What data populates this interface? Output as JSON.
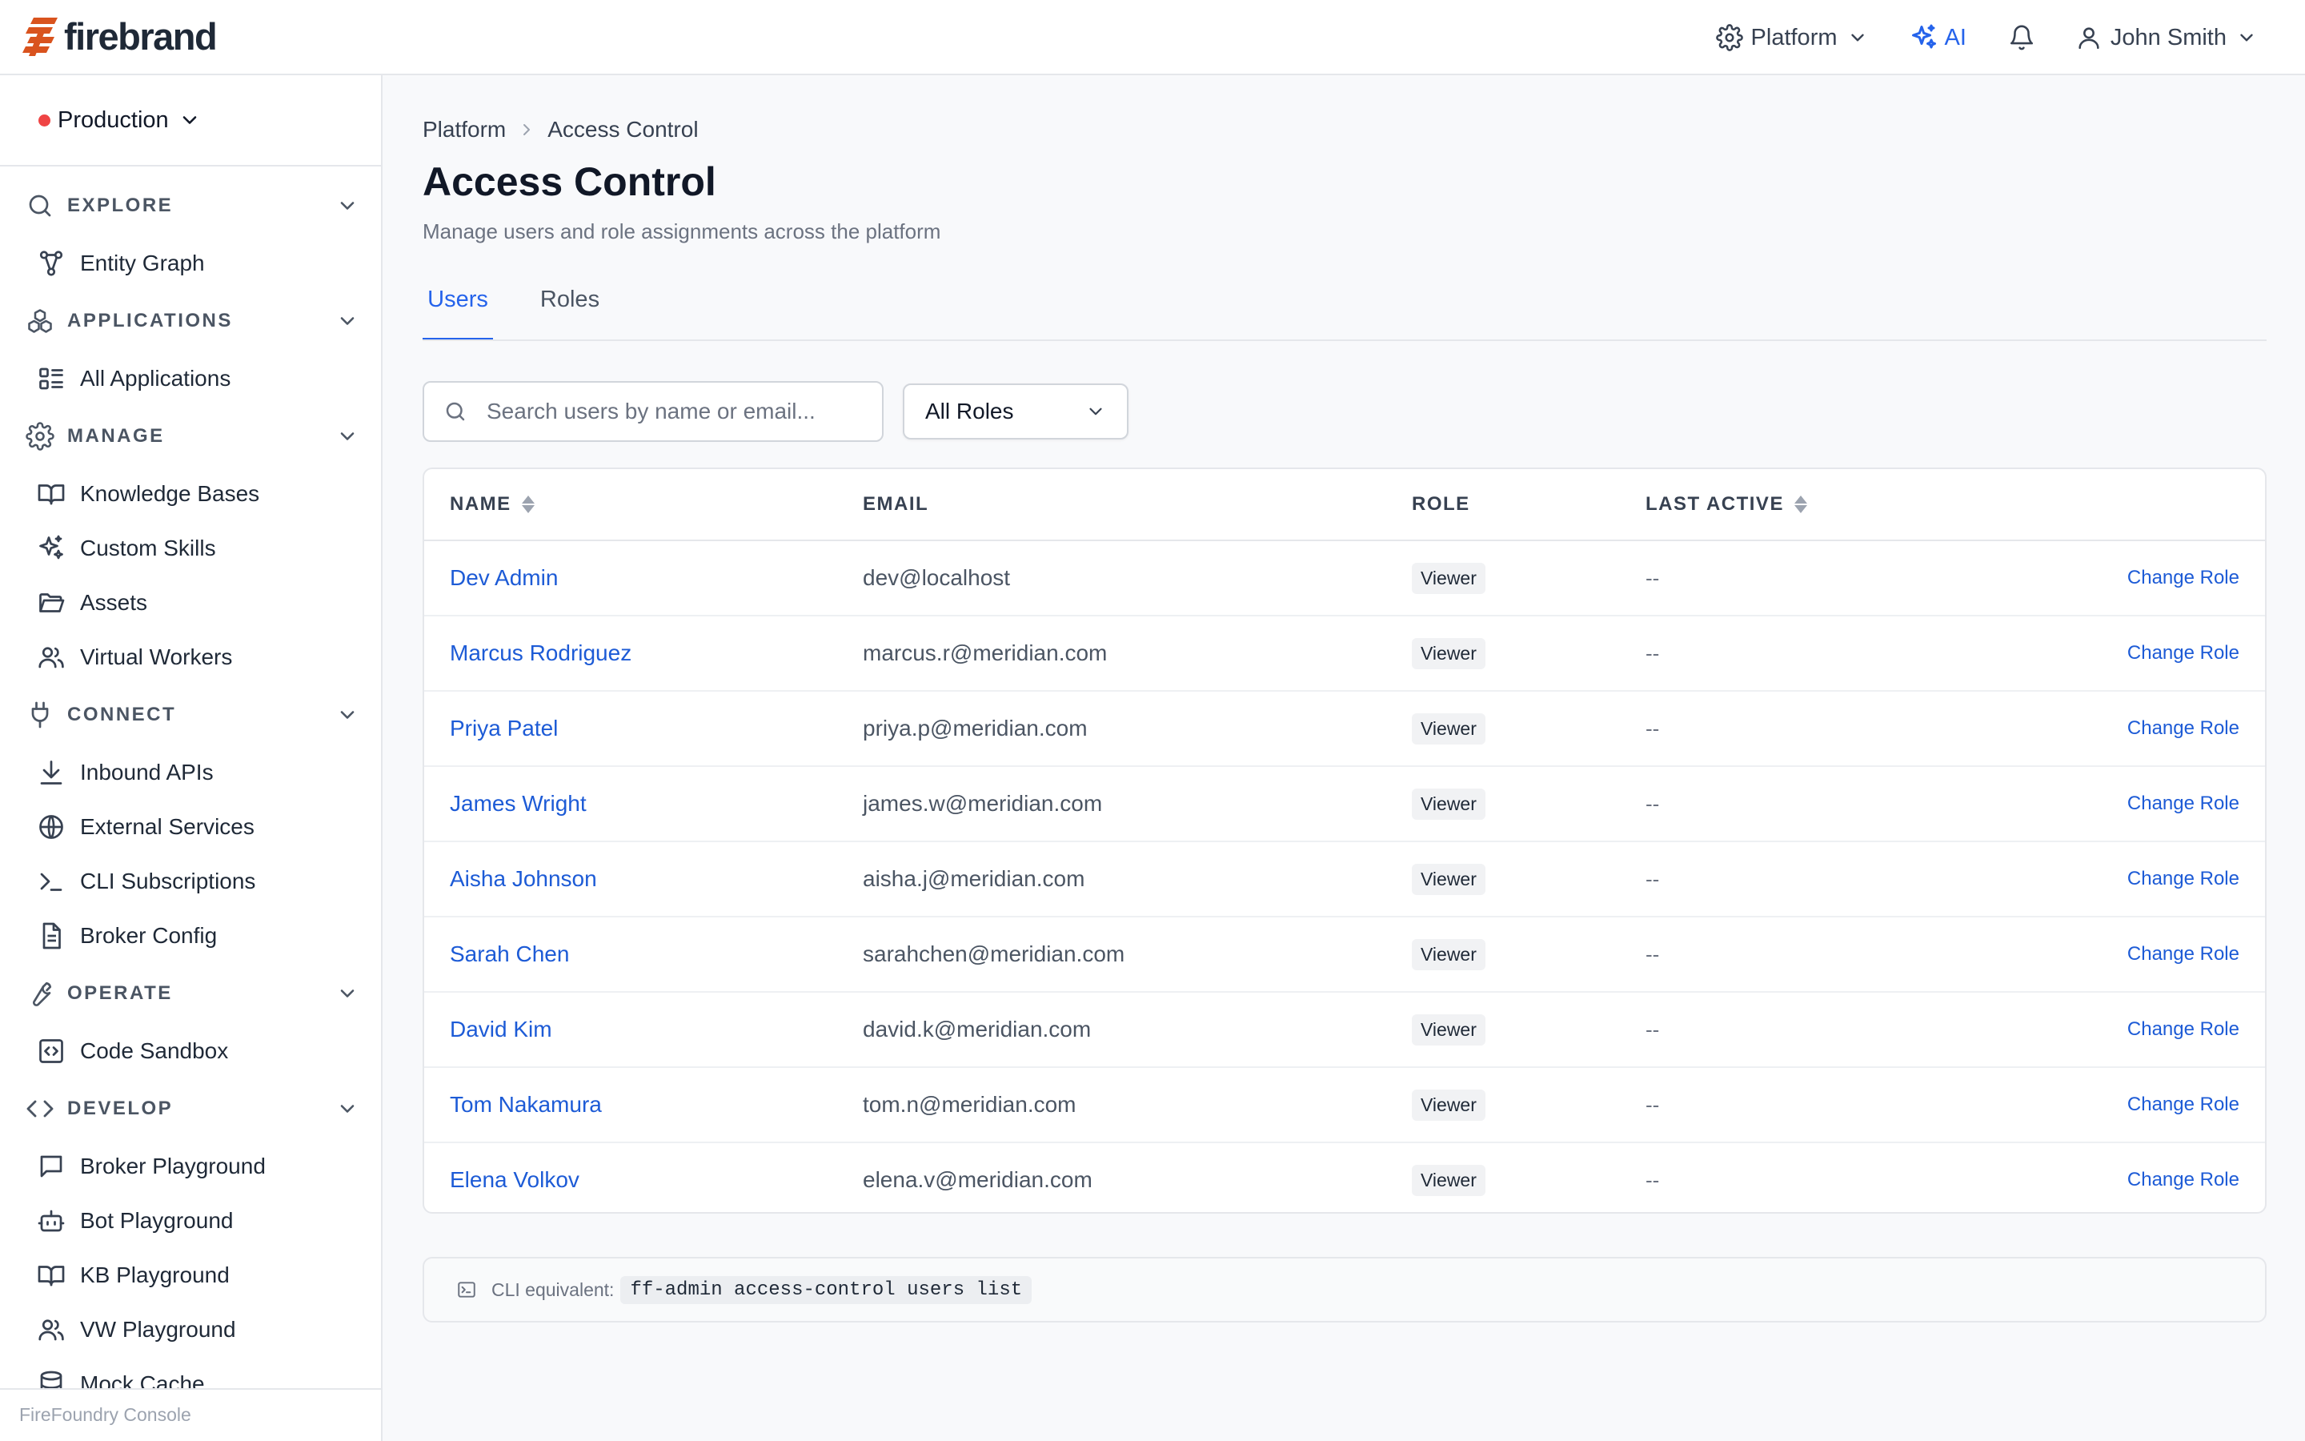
{
  "brand": {
    "name": "firebrand",
    "accent": "#d9531e",
    "link_color": "#1d5bd6"
  },
  "topnav": {
    "platform": "Platform",
    "ai": "AI",
    "user": "John Smith"
  },
  "sidebar": {
    "environment": {
      "label": "Production",
      "status_color": "#ef4444"
    },
    "sections": [
      {
        "label": "EXPLORE",
        "icon": "search-icon",
        "items": [
          {
            "label": "Entity Graph",
            "icon": "graph-icon"
          }
        ]
      },
      {
        "label": "APPLICATIONS",
        "icon": "applications-icon",
        "items": [
          {
            "label": "All Applications",
            "icon": "list-icon"
          }
        ]
      },
      {
        "label": "MANAGE",
        "icon": "gear-icon",
        "items": [
          {
            "label": "Knowledge Bases",
            "icon": "book-icon"
          },
          {
            "label": "Custom Skills",
            "icon": "sparkles-icon"
          },
          {
            "label": "Assets",
            "icon": "folder-icon"
          },
          {
            "label": "Virtual Workers",
            "icon": "users-icon"
          }
        ]
      },
      {
        "label": "CONNECT",
        "icon": "plug-icon",
        "items": [
          {
            "label": "Inbound APIs",
            "icon": "download-icon"
          },
          {
            "label": "External Services",
            "icon": "globe-icon"
          },
          {
            "label": "CLI Subscriptions",
            "icon": "terminal-icon"
          },
          {
            "label": "Broker Config",
            "icon": "document-icon"
          }
        ]
      },
      {
        "label": "OPERATE",
        "icon": "wrench-icon",
        "items": [
          {
            "label": "Code Sandbox",
            "icon": "code-box-icon"
          }
        ]
      },
      {
        "label": "DEVELOP",
        "icon": "code-icon",
        "items": [
          {
            "label": "Broker Playground",
            "icon": "chat-icon"
          },
          {
            "label": "Bot Playground",
            "icon": "bot-icon"
          },
          {
            "label": "KB Playground",
            "icon": "book-icon"
          },
          {
            "label": "VW Playground",
            "icon": "users-icon"
          },
          {
            "label": "Mock Cache",
            "icon": "database-icon"
          }
        ]
      }
    ],
    "footer": "FireFoundry Console"
  },
  "breadcrumb": {
    "parent": "Platform",
    "current": "Access Control"
  },
  "page": {
    "title": "Access Control",
    "subtitle": "Manage users and role assignments across the platform"
  },
  "tabs": [
    {
      "label": "Users",
      "active": true
    },
    {
      "label": "Roles",
      "active": false
    }
  ],
  "filters": {
    "search_placeholder": "Search users by name or email...",
    "search_value": "",
    "role_filter": "All Roles"
  },
  "table": {
    "headers": {
      "name": "NAME",
      "email": "EMAIL",
      "role": "ROLE",
      "last_active": "LAST ACTIVE"
    },
    "action_label": "Change Role",
    "rows": [
      {
        "name": "Dev Admin",
        "email": "dev@localhost",
        "role": "Viewer",
        "last_active": "--"
      },
      {
        "name": "Marcus Rodriguez",
        "email": "marcus.r@meridian.com",
        "role": "Viewer",
        "last_active": "--"
      },
      {
        "name": "Priya Patel",
        "email": "priya.p@meridian.com",
        "role": "Viewer",
        "last_active": "--"
      },
      {
        "name": "James Wright",
        "email": "james.w@meridian.com",
        "role": "Viewer",
        "last_active": "--"
      },
      {
        "name": "Aisha Johnson",
        "email": "aisha.j@meridian.com",
        "role": "Viewer",
        "last_active": "--"
      },
      {
        "name": "Sarah Chen",
        "email": "sarahchen@meridian.com",
        "role": "Viewer",
        "last_active": "--"
      },
      {
        "name": "David Kim",
        "email": "david.k@meridian.com",
        "role": "Viewer",
        "last_active": "--"
      },
      {
        "name": "Tom Nakamura",
        "email": "tom.n@meridian.com",
        "role": "Viewer",
        "last_active": "--"
      },
      {
        "name": "Elena Volkov",
        "email": "elena.v@meridian.com",
        "role": "Viewer",
        "last_active": "--"
      }
    ]
  },
  "cli": {
    "label": "CLI equivalent:",
    "command": "ff-admin access-control users list"
  }
}
